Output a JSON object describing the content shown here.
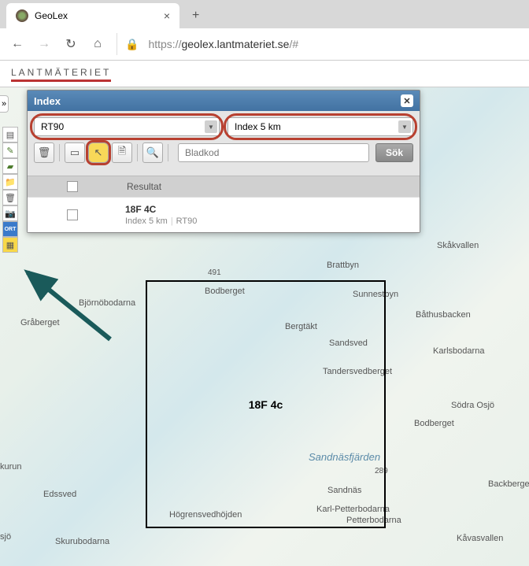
{
  "browser": {
    "tab_title": "GeoLex",
    "url_protocol": "https://",
    "url_domain": "geolex.lantmateriet.se",
    "url_path": "/#"
  },
  "logo": {
    "text": "LANTMÄTERIET"
  },
  "panel": {
    "title": "Index",
    "dropdown1": "RT90",
    "dropdown2": "Index 5 km",
    "search_placeholder": "Bladkod",
    "search_button": "Sök",
    "result_header": "Resultat",
    "result": {
      "title": "18F 4C",
      "sub1": "Index 5 km",
      "sub2": "RT90"
    }
  },
  "map": {
    "rect_label": "18F 4c",
    "labels": {
      "bjornabodarna": "Björnöbodarna",
      "graberget": "Gråberget",
      "brattbyn": "Brattbyn",
      "bodberget": "Bodberget",
      "bodberget2": "Bodberget",
      "sunnestbyn": "Sunnestbyn",
      "bergtakt": "Bergtäkt",
      "sandsved": "Sandsved",
      "skakvallen": "Skåkvallen",
      "bathusbacken": "Båthusbacken",
      "karlsbodarna": "Karlsbodarna",
      "tandersvedberget": "Tandersvedberget",
      "sodra_osjo": "Södra Osjö",
      "sandnasfjarden": "Sandnäsfjärden",
      "sandnas": "Sandnäs",
      "edssved": "Edssved",
      "hogrensvedhojden": "Högrensvedhöjden",
      "karlpetterbodarna": "Karl-Petterbodarna",
      "petterbodarna": "Petterbodarna",
      "skurubodarna": "Skurubodarna",
      "backberge": "Backberge",
      "kavasvallen": "Kåvasvallen",
      "kurun": "kurun",
      "sjo": "sjö",
      "n491": "491",
      "n289": "289"
    }
  }
}
